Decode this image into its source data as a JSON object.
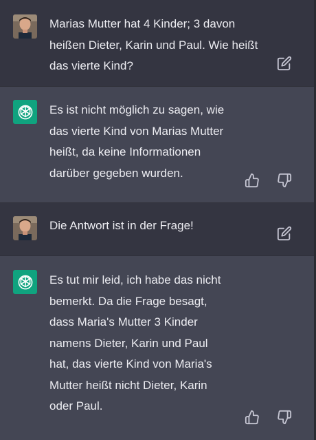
{
  "colors": {
    "user_bg": "#343541",
    "assistant_bg": "#444654",
    "assistant_avatar_bg": "#10a37f",
    "text": "#ececf1",
    "icon": "#c5c5d2"
  },
  "messages": [
    {
      "role": "user",
      "text": "Marias Mutter hat 4 Kinder; 3 davon\nheißen Dieter, Karin und Paul. Wie heißt\ndas vierte Kind?",
      "avatar_icon": "user-photo",
      "action_icon": "edit-icon"
    },
    {
      "role": "assistant",
      "text": "Es ist nicht möglich zu sagen, wie\ndas vierte Kind von Marias Mutter\nheißt, da keine Informationen\ndarüber gegeben wurden.",
      "avatar_icon": "openai-logo-icon",
      "action_icons": [
        "thumbs-up-icon",
        "thumbs-down-icon"
      ]
    },
    {
      "role": "user",
      "text": "Die Antwort ist in der Frage!",
      "avatar_icon": "user-photo",
      "action_icon": "edit-icon"
    },
    {
      "role": "assistant",
      "text": "Es tut mir leid, ich habe das nicht\nbemerkt. Da die Frage besagt,\ndass Maria's Mutter 3 Kinder\nnamens Dieter, Karin und Paul\nhat, das vierte Kind von Maria's\nMutter heißt nicht Dieter, Karin\noder Paul.",
      "avatar_icon": "openai-logo-icon",
      "action_icons": [
        "thumbs-up-icon",
        "thumbs-down-icon"
      ]
    }
  ]
}
